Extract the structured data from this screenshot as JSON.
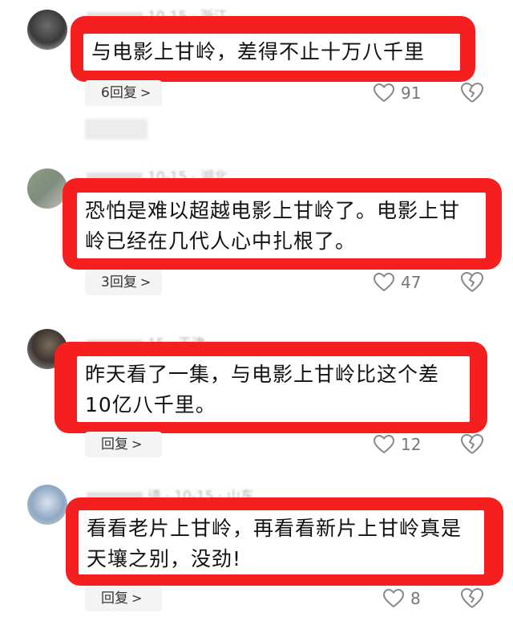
{
  "comments": [
    {
      "meta": "10-15 · 浙江",
      "text": "与电影上甘岭，差得不止十万八千里",
      "reply_label": "6回复",
      "likes": "91"
    },
    {
      "meta": "10-15 · 湖北",
      "text": "恐怕是难以超越电影上甘岭了。电影上甘岭已经在几代人心中扎根了。",
      "reply_label": "3回复",
      "likes": "47"
    },
    {
      "meta": "15 · 天津",
      "text": "昨天看了一集，与电影上甘岭比这个差10亿八千里。",
      "reply_label": "回复",
      "likes": "12"
    },
    {
      "meta": "请 · 10-15 · 山东",
      "text": "看看老片上甘岭，再看看新片上甘岭真是天壤之别，没劲!",
      "reply_label": "回复",
      "likes": "8"
    }
  ],
  "icons": {
    "reply_chevron": "chevron-right-icon",
    "like": "heart-icon",
    "dislike": "broken-heart-icon"
  },
  "colors": {
    "highlight": "#f51f1f",
    "muted": "#b5b5b5"
  }
}
